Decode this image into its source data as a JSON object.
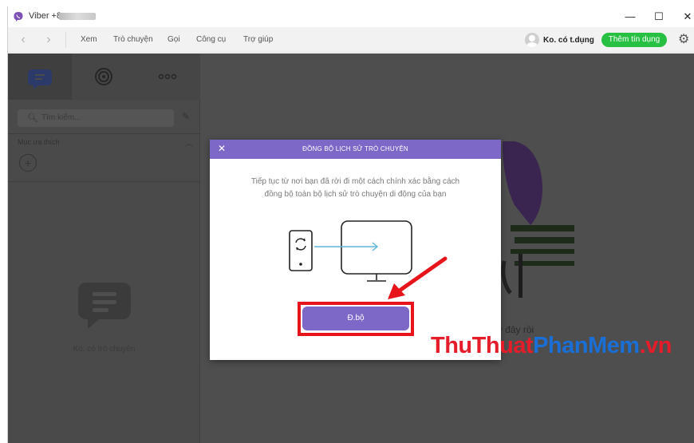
{
  "window": {
    "title": "Viber +8",
    "minimize_glyph": "—",
    "maximize_glyph": "☐",
    "close_glyph": "✕"
  },
  "menu": {
    "back_glyph": "‹",
    "forward_glyph": "›",
    "items": [
      "Xem",
      "Trò chuyện",
      "Gọi",
      "Công cụ",
      "Trợ giúp"
    ]
  },
  "account": {
    "name": "Ko. có t.dụng",
    "credit_button": "Thêm tín dụng",
    "settings_icon": "gear-icon"
  },
  "sidebar": {
    "tabs": [
      "chats-icon",
      "explore-icon",
      "more-icon"
    ],
    "search_placeholder": "Tìm kiếm...",
    "favorites_label": "Mục ưa thích",
    "add_glyph": "+",
    "empty_label": "Ko. có trò chuyện"
  },
  "background_text": "ở đây rồi",
  "dialog": {
    "close_glyph": "✕",
    "title": "ĐỒNG BỘ LỊCH SỬ TRÒ CHUYỆN",
    "description": "Tiếp tục từ nơi bạn đã rời đi một cách chính xác bằng cách đồng bộ toàn bộ lịch sử trò chuyện di động của bạn",
    "sync_button": "Đ.bộ",
    "accent_color": "#7d68c8"
  },
  "annotation": {
    "highlight_color": "#e8141b"
  },
  "watermark": {
    "part1": "ThuThuat",
    "part2": "PhanMem",
    "part3": ".vn"
  }
}
